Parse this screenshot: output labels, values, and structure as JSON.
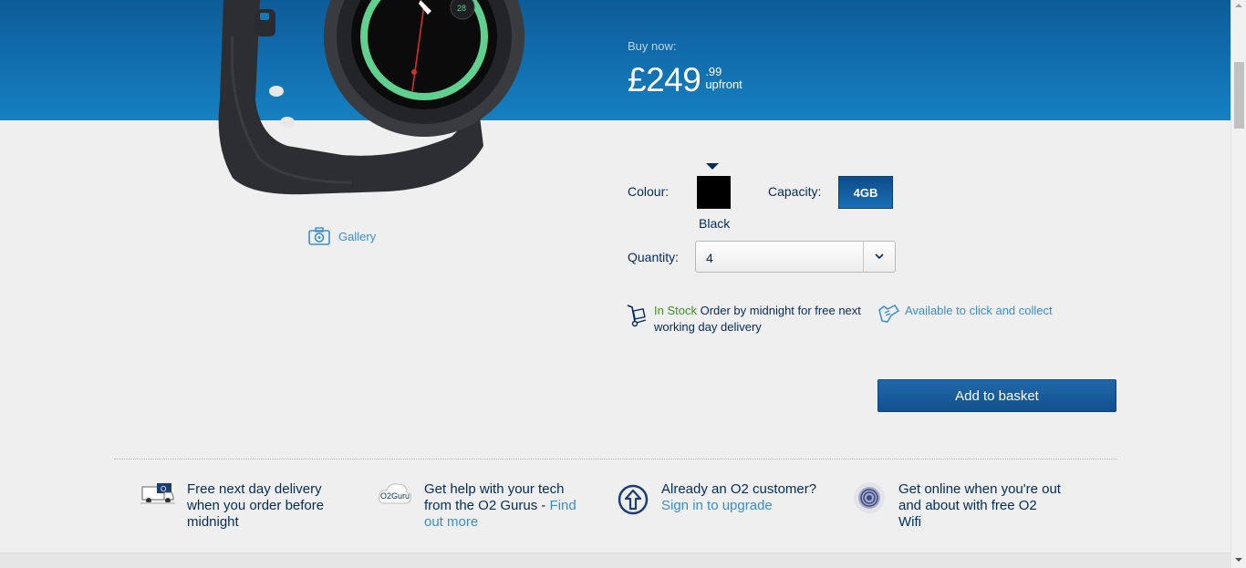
{
  "hero": {
    "buy_label": "Buy now:",
    "price_main": "£249",
    "price_pence": ".99",
    "price_suffix": "upfront",
    "watch_face_number": "28"
  },
  "product": {
    "gallery_label": "Gallery",
    "colour_label": "Colour:",
    "colour_name": "Black",
    "colour_hex": "#000000",
    "capacity_label": "Capacity:",
    "capacity_value": "4GB",
    "quantity_label": "Quantity:",
    "quantity_value": "4",
    "stock_status": "In Stock",
    "stock_detail": "Order by midnight for free next working day delivery",
    "click_collect": "Available to click and collect",
    "add_to_basket": "Add to basket"
  },
  "features": [
    {
      "icon": "delivery-van-icon",
      "text": "Free next day delivery when you order before midnight",
      "link": ""
    },
    {
      "icon": "o2-guru-icon",
      "text": "Get help with your tech from the O2 Gurus - ",
      "link": "Find out more",
      "icon_label": "O2Guru"
    },
    {
      "icon": "upgrade-arrow-icon",
      "text": "Already an O2 customer? ",
      "link": "Sign in to upgrade"
    },
    {
      "icon": "wifi-icon",
      "text": "Get online when you're out and about with free O2 Wifi",
      "link": ""
    }
  ],
  "colors": {
    "hero_blue": "#1680c1",
    "brand_navy": "#032b5a",
    "link_blue": "#3b8ecb",
    "stock_green": "#3f8f29"
  }
}
